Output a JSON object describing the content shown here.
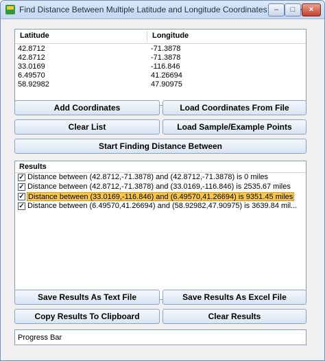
{
  "window": {
    "title": "Find Distance Between Multiple Latitude and Longitude Coordinates Software",
    "controls": {
      "minimize": "–",
      "maximize": "□",
      "close": "×"
    }
  },
  "coordinates": {
    "columns": [
      "Latitude",
      "Longitude"
    ],
    "rows": [
      [
        "42.8712",
        "-71.3878"
      ],
      [
        "42.8712",
        "-71.3878"
      ],
      [
        "33.0169",
        "-116.846"
      ],
      [
        "6.49570",
        "41.26694"
      ],
      [
        "58.92982",
        "47.90975"
      ]
    ]
  },
  "buttons": {
    "add_coordinates": "Add Coordinates",
    "load_from_file": "Load Coordinates From File",
    "clear_list": "Clear List",
    "load_sample": "Load Sample/Example Points",
    "start": "Start Finding Distance Between",
    "save_text": "Save Results As Text File",
    "save_excel": "Save Results As Excel File",
    "copy_clipboard": "Copy Results To Clipboard",
    "clear_results": "Clear Results"
  },
  "results": {
    "title": "Results",
    "items": [
      {
        "text": "Distance between (42.8712,-71.3878) and (42.8712,-71.3878) is 0 miles",
        "checked": true,
        "selected": false
      },
      {
        "text": "Distance between (42.8712,-71.3878) and (33.0169,-116.846) is 2535.67 miles",
        "checked": true,
        "selected": false
      },
      {
        "text": "Distance between (33.0169,-116.846) and (6.49570,41.26694) is 9351.45 miles",
        "checked": true,
        "selected": true
      },
      {
        "text": "Distance between (6.49570,41.26694) and (58.92982,47.90975) is 3639.84 mil...",
        "checked": true,
        "selected": false
      }
    ]
  },
  "status": {
    "progress_label": "Progress Bar"
  },
  "colors": {
    "selection": "#f8c74a",
    "button_border": "#8aa2c4",
    "title_bar": "#c4d7ef"
  }
}
